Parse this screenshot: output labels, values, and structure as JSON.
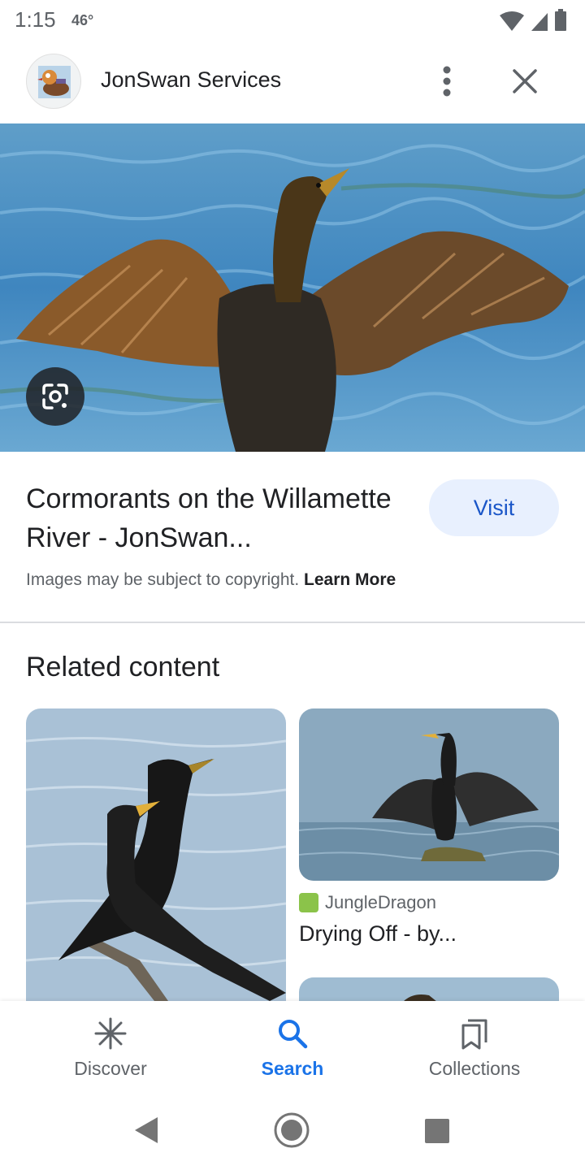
{
  "status_bar": {
    "time": "1:15",
    "temperature": "46°",
    "icons": [
      "wifi-icon",
      "signal-icon",
      "battery-icon"
    ]
  },
  "header": {
    "site_name": "JonSwan Services",
    "avatar_icon": "mandarin-duck-favicon",
    "more_icon": "more-vert-icon",
    "close_icon": "close-icon"
  },
  "hero": {
    "image": "cormorant-spreading-wings-over-water",
    "lens_icon": "google-lens-icon"
  },
  "result": {
    "title": "Cormorants on the Willamette River - JonSwan...",
    "visit_label": "Visit",
    "copyright_text": "Images may be subject to copyright.",
    "learn_more_label": "Learn More"
  },
  "related": {
    "heading": "Related content",
    "cards": [
      {
        "image": "two-cormorants-on-branch"
      },
      {
        "image": "cormorant-drying-wings-on-rock",
        "source": "JungleDragon",
        "caption": "Drying Off - by..."
      },
      {
        "image": "cormorant-partial-thumbnail"
      }
    ]
  },
  "bottom_nav": {
    "items": [
      {
        "label": "Discover",
        "icon": "discover-asterisk-icon",
        "active": false
      },
      {
        "label": "Search",
        "icon": "search-icon",
        "active": true
      },
      {
        "label": "Collections",
        "icon": "collections-bookmark-icon",
        "active": false
      }
    ]
  },
  "system_nav": {
    "icons": [
      "back-icon",
      "home-icon",
      "recents-icon"
    ]
  },
  "colors": {
    "accent": "#1a73e8",
    "visit_bg": "#e8f0fe",
    "text_primary": "#202124",
    "text_secondary": "#5f6368"
  }
}
